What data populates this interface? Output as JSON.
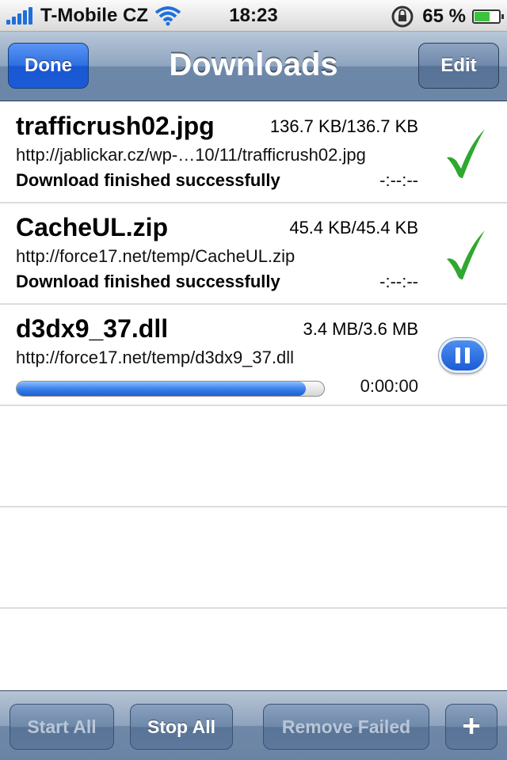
{
  "status_bar": {
    "carrier": "T-Mobile CZ",
    "time": "18:23",
    "battery_percent": "65 %",
    "battery_level": 0.65
  },
  "nav": {
    "title": "Downloads",
    "left_button": "Done",
    "right_button": "Edit"
  },
  "downloads": [
    {
      "filename": "trafficrush02.jpg",
      "size": "136.7 KB/136.7 KB",
      "url": "http://jablickar.cz/wp-…10/11/trafficrush02.jpg",
      "status": "Download finished successfully",
      "time": "-:--:--",
      "state_icon": "checkmark-icon"
    },
    {
      "filename": "CacheUL.zip",
      "size": "45.4 KB/45.4 KB",
      "url": "http://force17.net/temp/CacheUL.zip",
      "status": "Download finished successfully",
      "time": "-:--:--",
      "state_icon": "checkmark-icon"
    },
    {
      "filename": "d3dx9_37.dll",
      "size": "3.4 MB/3.6 MB",
      "url": "http://force17.net/temp/d3dx9_37.dll",
      "time": "0:00:00",
      "progress": 0.94,
      "state_icon": "pause-icon"
    }
  ],
  "toolbar": {
    "start_all": "Start All",
    "stop_all": "Stop All",
    "remove_failed": "Remove Failed",
    "add": "+"
  },
  "colors": {
    "checkmark": "#2fa82f",
    "accent_blue": "#1b5bd6",
    "nav_bar": "#6d87a8"
  }
}
